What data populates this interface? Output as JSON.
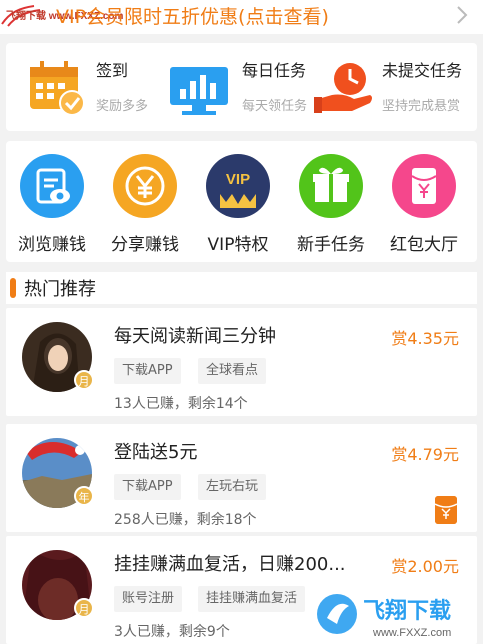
{
  "banner": {
    "watermark_text": "飞翔下载 www.FXXZ.com",
    "promo_text": "VIP会员限时五折优惠(点击查看)"
  },
  "tasks": [
    {
      "title": "签到",
      "subtitle": "奖励多多",
      "icon": "calendar-check-icon"
    },
    {
      "title": "每日任务",
      "subtitle": "每天领任务",
      "icon": "bar-chart-monitor-icon"
    },
    {
      "title": "未提交任务",
      "subtitle": "坚持完成悬赏",
      "icon": "hand-clock-icon"
    }
  ],
  "quick_actions": [
    {
      "label": "浏览赚钱",
      "icon": "browse-eye-icon",
      "color": "#2a9ff0"
    },
    {
      "label": "分享赚钱",
      "icon": "yen-coin-icon",
      "color": "#f5a623"
    },
    {
      "label": "VIP特权",
      "icon": "vip-crown-icon",
      "color": "#2b3a6b",
      "badge_text": "VIP"
    },
    {
      "label": "新手任务",
      "icon": "gift-box-icon",
      "color": "#52c41a"
    },
    {
      "label": "红包大厅",
      "icon": "red-envelope-icon",
      "color": "#f5478c"
    }
  ],
  "hot_section": {
    "title": "热门推荐"
  },
  "items": [
    {
      "title": "每天阅读新闻三分钟",
      "price": "赏4.35元",
      "tags": [
        "下载APP",
        "全球看点"
      ],
      "stat": "13人已赚，剩余14个",
      "badge": "月"
    },
    {
      "title": "登陆送5元",
      "price": "赏4.79元",
      "tags": [
        "下载APP",
        "左玩右玩"
      ],
      "stat": "258人已赚，剩余18个",
      "badge": "年"
    },
    {
      "title": "挂挂赚满血复活，日赚200...",
      "price": "赏2.00元",
      "tags": [
        "账号注册",
        "挂挂赚满血复活"
      ],
      "stat": "3人已赚，剩余9个",
      "badge": "月"
    }
  ],
  "footer_watermark": {
    "brand": "飞翔下载",
    "url": "www.FXXZ.com"
  },
  "colors": {
    "accent": "#f07d16",
    "background": "#f2f2f2"
  }
}
